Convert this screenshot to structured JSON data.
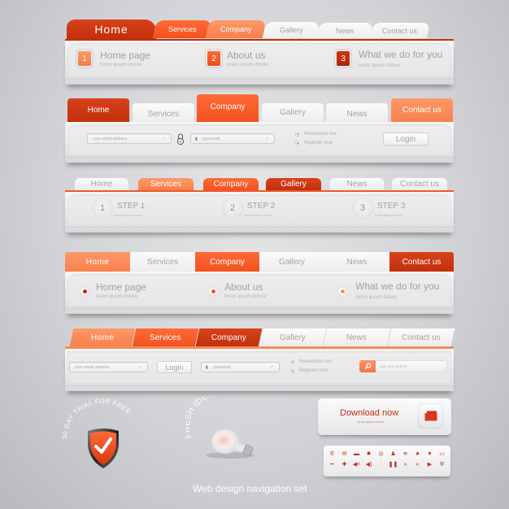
{
  "nav1": {
    "tabs": [
      {
        "label": "Home",
        "style": "active-dark"
      },
      {
        "label": "Services",
        "style": "mid"
      },
      {
        "label": "Company",
        "style": "pale"
      },
      {
        "label": "Gallery",
        "style": "light"
      },
      {
        "label": "News",
        "style": "light"
      },
      {
        "label": "Contact us",
        "style": "light"
      }
    ],
    "items": [
      {
        "number": "1",
        "title": "Home page",
        "subtitle": "lorem ipsum dolore"
      },
      {
        "number": "2",
        "title": "About us",
        "subtitle": "lorem ipsum dolore"
      },
      {
        "number": "3",
        "title": "What we do for you",
        "subtitle": "lorem ipsum dolore"
      }
    ]
  },
  "nav2": {
    "tabs": [
      {
        "label": "Home",
        "style": "dark"
      },
      {
        "label": "Services",
        "style": "light"
      },
      {
        "label": "Company",
        "style": "active-mid"
      },
      {
        "label": "Gallery",
        "style": "light"
      },
      {
        "label": "News",
        "style": "light"
      },
      {
        "label": "Contact us",
        "style": "pale"
      }
    ],
    "email_placeholder": "your email address",
    "password_placeholder": "password",
    "remember_label": "Remember me",
    "register_label": "Register now",
    "login_label": "Login"
  },
  "nav3": {
    "tabs": [
      {
        "label": "Home",
        "style": "light"
      },
      {
        "label": "Services",
        "style": "pale"
      },
      {
        "label": "Company",
        "style": "mid"
      },
      {
        "label": "Gallery",
        "style": "active-dark"
      },
      {
        "label": "News",
        "style": "light"
      },
      {
        "label": "Contact us",
        "style": "light"
      }
    ],
    "steps": [
      {
        "number": "1",
        "label": "STEP 1",
        "subtitle": "lorem ipsum dolore"
      },
      {
        "number": "2",
        "label": "STEP 2",
        "subtitle": "lorem ipsum dolore"
      },
      {
        "number": "3",
        "label": "STEP 3",
        "subtitle": "lorem ipsum dolore"
      }
    ]
  },
  "nav4": {
    "tabs": [
      {
        "label": "Home",
        "style": "pale"
      },
      {
        "label": "Services",
        "style": "light"
      },
      {
        "label": "Company",
        "style": "mid"
      },
      {
        "label": "Gallery",
        "style": "light"
      },
      {
        "label": "News",
        "style": "light"
      },
      {
        "label": "Contact us",
        "style": "active-dark"
      }
    ],
    "items": [
      {
        "title": "Home page",
        "subtitle": "lorem ipsum dolore",
        "dot_color": "#c0280f"
      },
      {
        "title": "About us",
        "subtitle": "lorem ipsum dolore",
        "dot_color": "#f0562a"
      },
      {
        "title": "What we do for you",
        "subtitle": "lorem ipsum dolore",
        "dot_color": "#f7905c"
      }
    ]
  },
  "nav5": {
    "tabs": [
      {
        "label": "Home",
        "style": "pale"
      },
      {
        "label": "Services",
        "style": "mid"
      },
      {
        "label": "Company",
        "style": "active-dark"
      },
      {
        "label": "Gallery",
        "style": "light"
      },
      {
        "label": "News",
        "style": "light"
      },
      {
        "label": "Contact us",
        "style": "light"
      }
    ],
    "email_placeholder": "your email address",
    "login_label": "Login",
    "password_placeholder": "password",
    "remember_label": "Remember me",
    "register_label": "Register now",
    "search_placeholder": "type your search..."
  },
  "badges": {
    "trial_text": "30 DAY TRIAL FOR FREE",
    "idea_text": "FRESH IDEA"
  },
  "download": {
    "label": "Download now",
    "subtitle": "lorem ipsum dolore"
  },
  "icon_set": {
    "row1": [
      "phone-icon",
      "mail-icon",
      "briefcase-icon",
      "gear-icon",
      "target-icon",
      "user-icon",
      "rss-icon",
      "star-icon",
      "heart-icon",
      "monitor-icon"
    ],
    "row2": [
      "minus-icon",
      "plus-icon",
      "mute-icon",
      "volume-icon",
      "equalizer-icon",
      "pause-icon",
      "fast-forward-icon",
      "rewind-icon",
      "play-icon",
      "shield-icon"
    ],
    "glyphs1": [
      "✆",
      "✉",
      "▬",
      "✹",
      "◎",
      "♟",
      "≋",
      "★",
      "♥",
      "▭"
    ],
    "glyphs2": [
      "━",
      "✚",
      "◀×",
      "◀)",
      "⫶",
      "❚❚",
      "»",
      "«",
      "▶",
      "⛨"
    ]
  },
  "caption": "Web design navigation set",
  "colors": {
    "dark": "#c9330f",
    "mid": "#f85a28",
    "pale": "#fb8c5a",
    "text_gray": "#a1a1a3"
  }
}
